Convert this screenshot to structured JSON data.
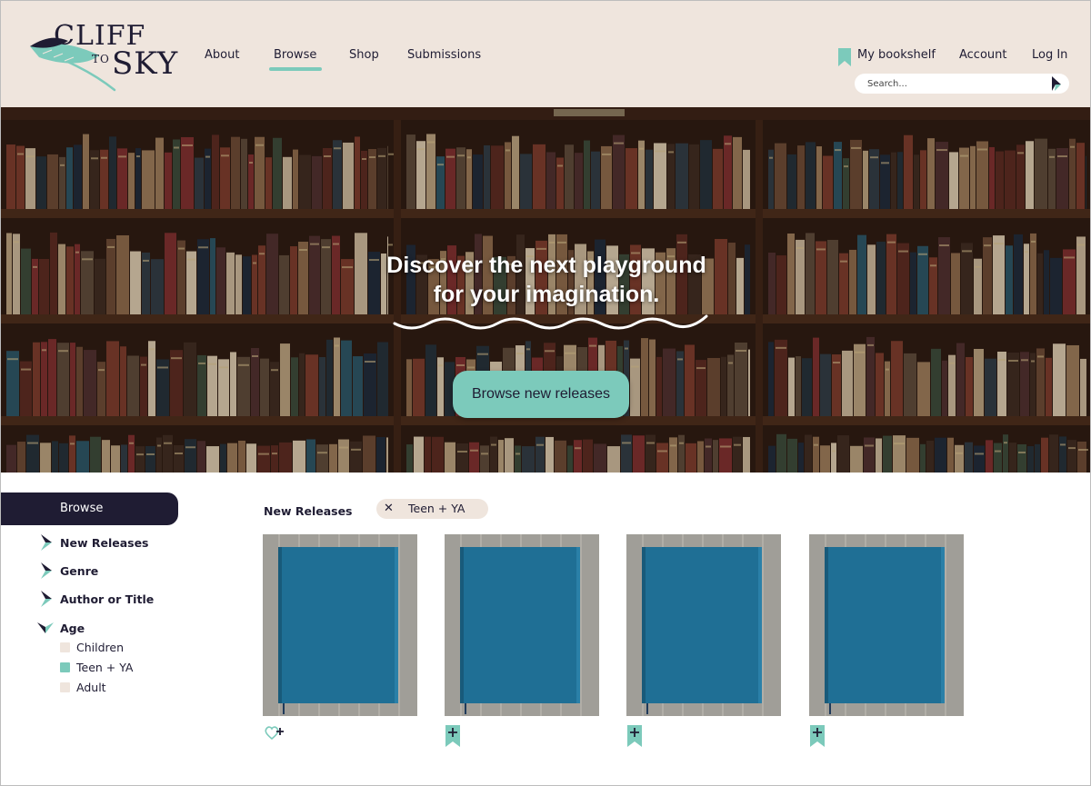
{
  "brand": {
    "logo_words": [
      "CLIFF",
      "TO",
      "SKY"
    ],
    "colors": {
      "primary": "#1f1c33",
      "accent": "#7ccabb",
      "cream": "#efe5dd"
    }
  },
  "nav": {
    "items": [
      {
        "label": "About"
      },
      {
        "label": "Browse",
        "active": true
      },
      {
        "label": "Shop"
      },
      {
        "label": "Submissions"
      }
    ]
  },
  "utility": {
    "bookshelf_label": "My bookshelf",
    "bookshelf_icon": "bookmark-icon",
    "account_label": "Account",
    "login_label": "Log In",
    "search_placeholder": "Search...",
    "search_icon": "arrow-icon"
  },
  "hero": {
    "title_line1": "Discover the next playground",
    "title_line2": "for your imagination.",
    "cta_label": "Browse new releases"
  },
  "sidebar": {
    "header": "Browse",
    "items": [
      {
        "label": "New Releases",
        "expanded": false
      },
      {
        "label": "Genre",
        "expanded": false
      },
      {
        "label": "Author or Title",
        "expanded": false
      },
      {
        "label": "Age",
        "expanded": true
      }
    ],
    "age_options": [
      {
        "label": "Children",
        "checked": false
      },
      {
        "label": "Teen + YA",
        "checked": true
      },
      {
        "label": "Adult",
        "checked": false
      }
    ]
  },
  "content": {
    "section_title": "New Releases",
    "active_filter": {
      "label": "Teen + YA",
      "remove_icon": "close-icon"
    },
    "books": [
      {
        "action_icon": "heart-plus-icon"
      },
      {
        "action_icon": "bookmark-plus-icon"
      },
      {
        "action_icon": "bookmark-plus-icon"
      },
      {
        "action_icon": "bookmark-plus-icon"
      }
    ]
  }
}
